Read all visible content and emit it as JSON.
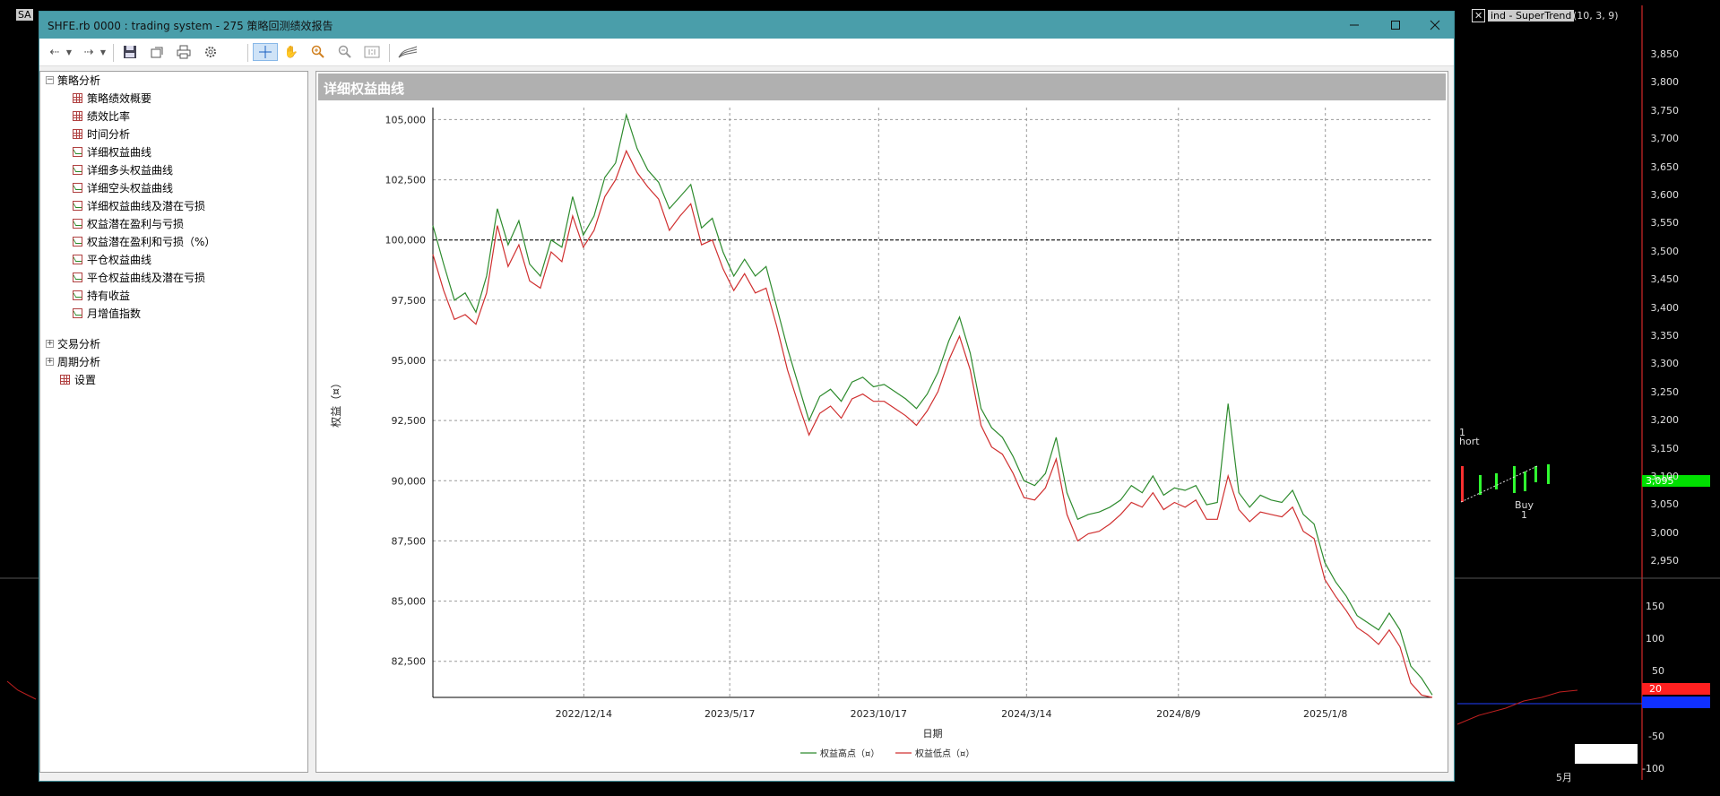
{
  "window": {
    "title": "SHFE.rb 0000 : trading system - 275 策略回测绩效报告"
  },
  "tree": {
    "root": "策略分析",
    "items": [
      {
        "label": "策略绩效概要",
        "icon": "grid"
      },
      {
        "label": "绩效比率",
        "icon": "grid"
      },
      {
        "label": "时间分析",
        "icon": "grid"
      },
      {
        "label": "详细权益曲线",
        "icon": "chart"
      },
      {
        "label": "详细多头权益曲线",
        "icon": "chart"
      },
      {
        "label": "详细空头权益曲线",
        "icon": "chart"
      },
      {
        "label": "详细权益曲线及潜在亏损",
        "icon": "chart"
      },
      {
        "label": "权益潜在盈利与亏损",
        "icon": "chart"
      },
      {
        "label": "权益潜在盈利和亏损（%）",
        "icon": "chart"
      },
      {
        "label": "平仓权益曲线",
        "icon": "chart"
      },
      {
        "label": "平仓权益曲线及潜在亏损",
        "icon": "chart"
      },
      {
        "label": "持有收益",
        "icon": "chart"
      },
      {
        "label": "月增值指数",
        "icon": "chart"
      }
    ],
    "collapsed": [
      "交易分析",
      "周期分析"
    ],
    "settings": "设置"
  },
  "panel": {
    "title": "详细权益曲线"
  },
  "background": {
    "indicator_label": "ind - SuperTrend",
    "indicator_params": "(10, 3, 9)",
    "short_label": "hort",
    "buy_label": "Buy",
    "buy_count": "1",
    "short_count": "1",
    "current_price": "3,095",
    "osc_value": "20",
    "month_label": "5月",
    "price_ticks": [
      "3,850",
      "3,800",
      "3,750",
      "3,700",
      "3,650",
      "3,600",
      "3,550",
      "3,500",
      "3,450",
      "3,400",
      "3,350",
      "3,300",
      "3,250",
      "3,200",
      "3,150",
      "3,100",
      "3,050",
      "3,000",
      "2,950"
    ],
    "osc_ticks": [
      "150",
      "100",
      "50",
      "-50",
      "-100"
    ],
    "badge_left": "SA",
    "badge_close": "✕"
  },
  "chart_data": {
    "type": "line",
    "xlabel": "日期",
    "ylabel": "权益（¤）",
    "ylim": [
      81000,
      105500
    ],
    "y_ticks": [
      82500,
      85000,
      87500,
      90000,
      92500,
      95000,
      97500,
      100000,
      102500,
      105000
    ],
    "y_tick_labels": [
      "82,500",
      "85,000",
      "87,500",
      "90,000",
      "92,500",
      "95,000",
      "97,500",
      "100,000",
      "102,500",
      "105,000"
    ],
    "x_tick_labels": [
      "2022/12/14",
      "2023/5/17",
      "2023/10/17",
      "2024/3/14",
      "2024/8/9",
      "2025/1/8"
    ],
    "reference_line": 100000,
    "grid": true,
    "legend": "bottom",
    "series": [
      {
        "name": "权益高点（¤）",
        "color": "#2e8b2e",
        "values": [
          100600,
          99000,
          97500,
          97800,
          97000,
          98500,
          101300,
          99800,
          100800,
          99000,
          98500,
          100000,
          99700,
          101800,
          100200,
          101000,
          102600,
          103200,
          105200,
          103800,
          102900,
          102400,
          101300,
          101800,
          102300,
          100500,
          100900,
          99500,
          98500,
          99200,
          98500,
          98900,
          97200,
          95500,
          94000,
          92500,
          93500,
          93800,
          93300,
          94100,
          94300,
          93900,
          94000,
          93700,
          93400,
          93000,
          93600,
          94500,
          95800,
          96800,
          95300,
          93000,
          92200,
          91800,
          91000,
          90000,
          89800,
          90300,
          91800,
          89500,
          88400,
          88600,
          88700,
          88900,
          89200,
          89800,
          89500,
          90200,
          89400,
          89700,
          89600,
          89800,
          89000,
          89100,
          93200,
          89500,
          88900,
          89400,
          89200,
          89100,
          89600,
          88600,
          88200,
          86600,
          85800,
          85200,
          84400,
          84100,
          83800,
          84500,
          83800,
          82300,
          81800,
          81100
        ]
      },
      {
        "name": "权益低点（¤）",
        "color": "#d03030",
        "values": [
          99400,
          97900,
          96700,
          96900,
          96500,
          97800,
          100600,
          98900,
          99800,
          98300,
          98000,
          99500,
          99100,
          101000,
          99700,
          100400,
          101800,
          102500,
          103700,
          102800,
          102200,
          101700,
          100400,
          101000,
          101500,
          99800,
          100000,
          98800,
          97900,
          98600,
          97800,
          98000,
          96400,
          94600,
          93200,
          91900,
          92800,
          93100,
          92600,
          93400,
          93600,
          93300,
          93300,
          93000,
          92700,
          92300,
          92900,
          93700,
          95000,
          96000,
          94600,
          92300,
          91400,
          91100,
          90300,
          89300,
          89200,
          89700,
          90900,
          88600,
          87500,
          87800,
          87900,
          88200,
          88600,
          89100,
          88900,
          89500,
          88800,
          89100,
          88900,
          89200,
          88400,
          88400,
          90200,
          88800,
          88300,
          88700,
          88600,
          88500,
          88900,
          87900,
          87600,
          85900,
          85200,
          84600,
          83900,
          83600,
          83200,
          83800,
          83100,
          81600,
          81100,
          81000
        ]
      }
    ]
  }
}
